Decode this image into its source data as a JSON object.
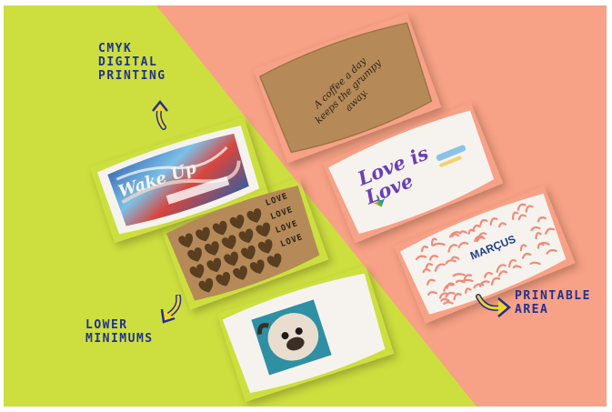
{
  "colors": {
    "lime_background": "#ccdf3f",
    "coral_background": "#f7a186",
    "callout_ink": "#23308f",
    "callout_arrow": "#f0d62a",
    "kraft": "#b58a58",
    "sleeve_white": "#f6f3ee"
  },
  "callouts": {
    "cmyk": "CMYK\nDIGITAL\nPRINTING",
    "lower": "LOWER\nMINIMUMS",
    "printable": "PRINTABLE\nAREA"
  },
  "sleeves": {
    "kraft_tagline": {
      "line1": "A coffee a day",
      "line2": "keeps the grumpy away."
    },
    "love_is_love": {
      "text": "Love is Love"
    },
    "hearts": {
      "word": "LOVE"
    },
    "printable": {
      "brand": "MARÇUS"
    },
    "wake_up": {
      "headline": "Wake Up"
    }
  },
  "icons": {
    "cmyk_arrow": "curved-arrow-up-icon",
    "lower_arrow": "curved-arrow-down-icon",
    "printable_arrow": "curved-arrow-right-icon"
  }
}
